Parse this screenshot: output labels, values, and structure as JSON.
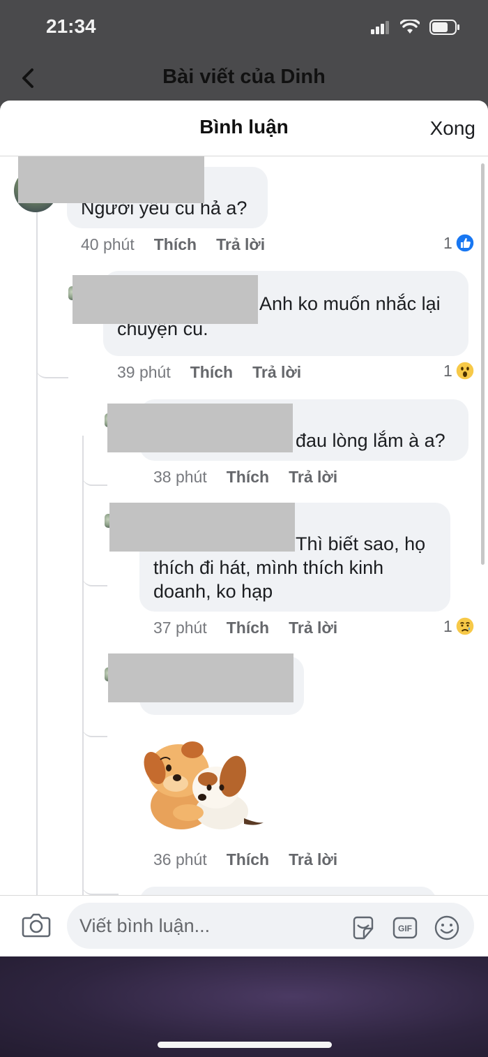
{
  "status_bar": {
    "time": "21:34"
  },
  "background_page": {
    "title": "Bài viết của Dinh"
  },
  "sheet": {
    "title": "Bình luận",
    "done_label": "Xong"
  },
  "comments": [
    {
      "text": "Người yêu cũ hả a?",
      "time": "40 phút",
      "like": "Thích",
      "reply": "Trả lời",
      "reaction_count": "1",
      "reaction": "like"
    },
    {
      "text_line1": "Anh ko muốn nhắc lại",
      "text_line2": "chuyện cũ.",
      "time": "39 phút",
      "like": "Thích",
      "reply": "Trả lời",
      "reaction_count": "1",
      "reaction": "wow"
    },
    {
      "text": "đau lòng lắm à a?",
      "time": "38 phút",
      "like": "Thích",
      "reply": "Trả lời"
    },
    {
      "text_line1": "Thì biết sao, họ",
      "text_line2": "thích đi hát, mình thích kinh",
      "text_line3": "doanh, ko hạp",
      "time": "37 phút",
      "like": "Thích",
      "reply": "Trả lời",
      "reaction_count": "1",
      "reaction": "sad"
    },
    {
      "sticker": "two-dogs-hugging-sticker",
      "time": "36 phút",
      "like": "Thích",
      "reply": "Trả lời"
    }
  ],
  "composer": {
    "placeholder": "Viết bình luận..."
  },
  "colors": {
    "like_blue": "#1877f2",
    "bubble_gray": "#f0f2f5",
    "mention_blue": "#5b8fd9"
  }
}
